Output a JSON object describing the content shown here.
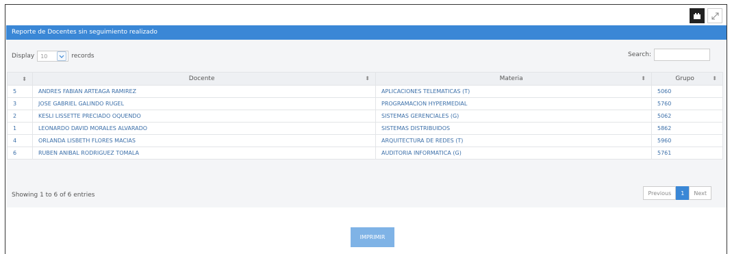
{
  "panel": {
    "title": "Reporte de Docentes sin seguimiento realizado"
  },
  "toolbar": {
    "fullscreen_icon": "expand-icon",
    "calendar_icon": "calendar-icon"
  },
  "length": {
    "prefix": "Display",
    "selected": "10",
    "suffix": "records"
  },
  "search": {
    "label": "Search:",
    "value": ""
  },
  "table": {
    "headers": [
      "",
      "Docente",
      "Materia",
      "Grupo"
    ],
    "rows": [
      [
        "5",
        "ANDRES FABIAN ARTEAGA RAMIREZ",
        "APLICACIONES TELEMATICAS (T)",
        "5060"
      ],
      [
        "3",
        "JOSE GABRIEL GALINDO RUGEL",
        "PROGRAMACION HYPERMEDIAL",
        "5760"
      ],
      [
        "2",
        "KESLI LISSETTE PRECIADO OQUENDO",
        "SISTEMAS GERENCIALES (G)",
        "5062"
      ],
      [
        "1",
        "LEONARDO DAVID MORALES ALVARADO",
        "SISTEMAS DISTRIBUIDOS",
        "5862"
      ],
      [
        "4",
        "ORLANDA LISBETH FLORES MACIAS",
        "ARQUITECTURA DE REDES (T)",
        "5960"
      ],
      [
        "6",
        "RUBEN ANIBAL RODRIGUEZ TOMALA",
        "AUDITORIA INFORMATICA (G)",
        "5761"
      ]
    ]
  },
  "info": "Showing 1 to 6 of 6 entries",
  "pagination": {
    "previous": "Previous",
    "current": "1",
    "next": "Next"
  },
  "actions": {
    "print": "IMPRIMIR"
  },
  "colors": {
    "accent": "#3a87d6",
    "link": "#3a6ea8"
  }
}
